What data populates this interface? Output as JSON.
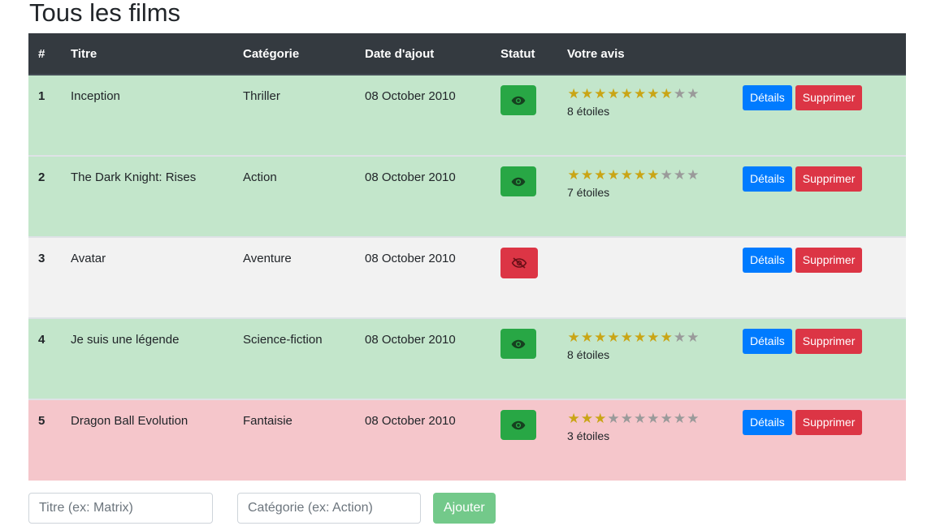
{
  "page": {
    "title": "Tous les films"
  },
  "table": {
    "headers": {
      "num": "#",
      "title": "Titre",
      "category": "Catégorie",
      "date": "Date d'ajout",
      "status": "Statut",
      "rating": "Votre avis"
    },
    "rows": [
      {
        "num": "1",
        "title": "Inception",
        "category": "Thriller",
        "date": "08 October 2010",
        "status": "seen",
        "status_icon": "eye-icon",
        "stars": 8,
        "stars_max": 10,
        "stars_text": "8 étoiles",
        "row_color": "#c3e6cb"
      },
      {
        "num": "2",
        "title": "The Dark Knight: Rises",
        "category": "Action",
        "date": "08 October 2010",
        "status": "seen",
        "status_icon": "eye-icon",
        "stars": 7,
        "stars_max": 10,
        "stars_text": "7 étoiles",
        "row_color": "#c3e6cb"
      },
      {
        "num": "3",
        "title": "Avatar",
        "category": "Aventure",
        "date": "08 October 2010",
        "status": "unseen",
        "status_icon": "eye-slash-icon",
        "stars": 0,
        "stars_max": 10,
        "stars_text": "",
        "row_color": "#f2f2f2"
      },
      {
        "num": "4",
        "title": "Je suis une légende",
        "category": "Science-fiction",
        "date": "08 October 2010",
        "status": "seen",
        "status_icon": "eye-icon",
        "stars": 8,
        "stars_max": 10,
        "stars_text": "8 étoiles",
        "row_color": "#c3e6cb"
      },
      {
        "num": "5",
        "title": "Dragon Ball Evolution",
        "category": "Fantaisie",
        "date": "08 October 2010",
        "status": "seen",
        "status_icon": "eye-icon",
        "stars": 3,
        "stars_max": 10,
        "stars_text": "3 étoiles",
        "row_color": "#f5c6cb"
      }
    ],
    "actions": {
      "details_label": "Détails",
      "delete_label": "Supprimer"
    }
  },
  "form": {
    "title_placeholder": "Titre (ex: Matrix)",
    "category_placeholder": "Catégorie (ex: Action)",
    "add_label": "Ajouter"
  },
  "colors": {
    "header_bg": "#343a40",
    "seen": "#28a745",
    "unseen": "#dc3545",
    "primary": "#007bff",
    "danger": "#dc3545",
    "star_on": "#c9a516",
    "star_off": "#9a9a9a",
    "add_button": "#73c98a"
  }
}
